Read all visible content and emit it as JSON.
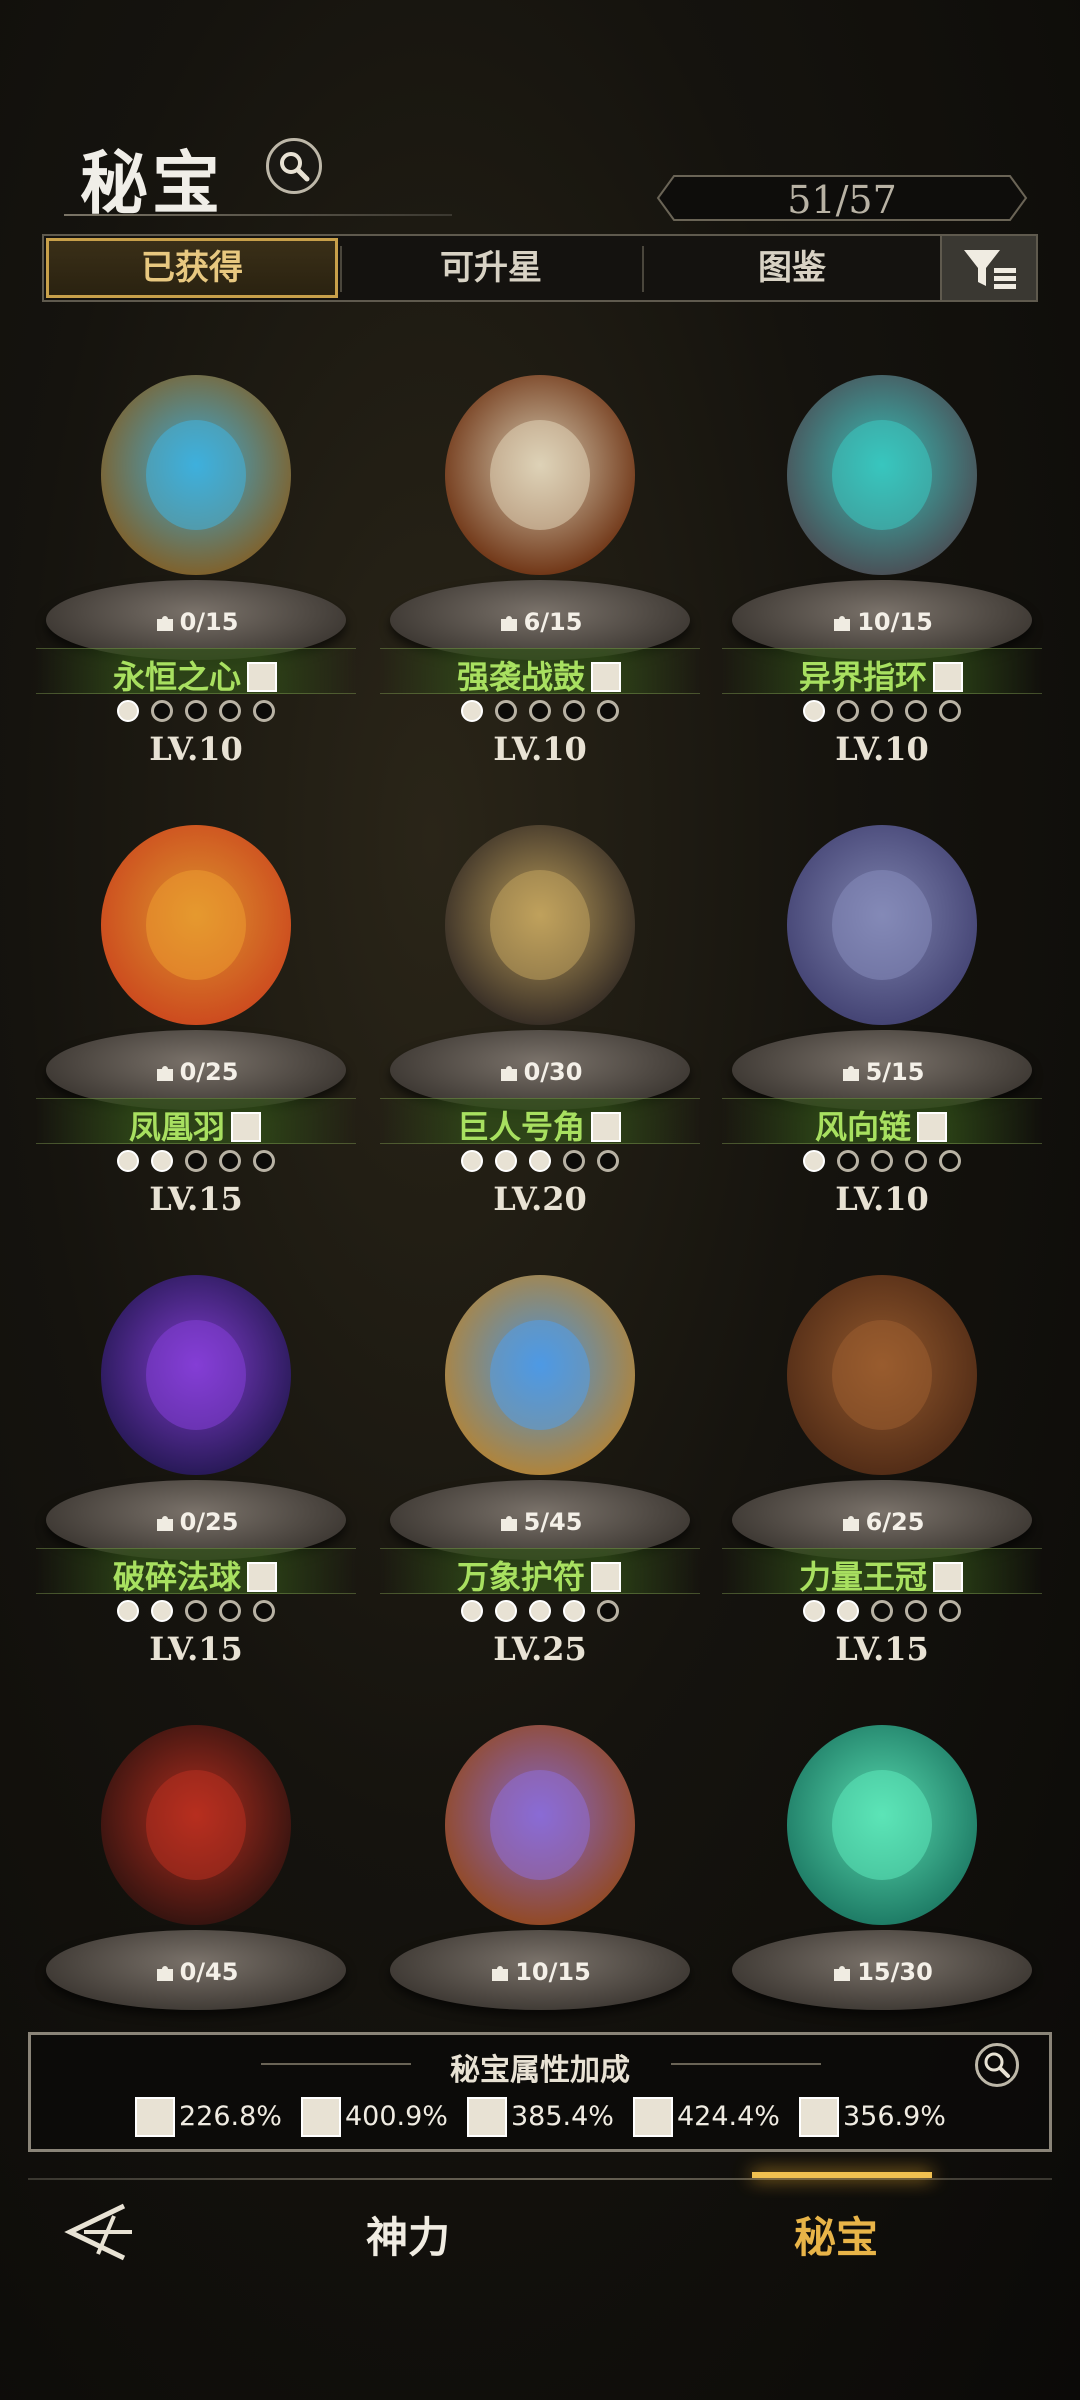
{
  "header": {
    "title": "秘宝",
    "count": "51/57"
  },
  "tabs": [
    {
      "label": "已获得",
      "active": true
    },
    {
      "label": "可升星",
      "active": false
    },
    {
      "label": "图鉴",
      "active": false
    }
  ],
  "items": [
    {
      "name": "永恒之心",
      "fragments": "0/15",
      "level": "LV.10",
      "stars_lit": 1,
      "stars_total": 5,
      "type_icon": "swirl-icon"
    },
    {
      "name": "强袭战鼓",
      "fragments": "6/15",
      "level": "LV.10",
      "stars_lit": 1,
      "stars_total": 5,
      "type_icon": "fist-icon"
    },
    {
      "name": "异界指环",
      "fragments": "10/15",
      "level": "LV.10",
      "stars_lit": 1,
      "stars_total": 5,
      "type_icon": "heart-icon"
    },
    {
      "name": "凤凰羽",
      "fragments": "0/25",
      "level": "LV.15",
      "stars_lit": 2,
      "stars_total": 5,
      "type_icon": "fist-icon"
    },
    {
      "name": "巨人号角",
      "fragments": "0/30",
      "level": "LV.20",
      "stars_lit": 3,
      "stars_total": 5,
      "type_icon": "boot-icon"
    },
    {
      "name": "风向链",
      "fragments": "5/15",
      "level": "LV.10",
      "stars_lit": 1,
      "stars_total": 5,
      "type_icon": "fist-icon"
    },
    {
      "name": "破碎法球",
      "fragments": "0/25",
      "level": "LV.15",
      "stars_lit": 2,
      "stars_total": 5,
      "type_icon": "boot-icon"
    },
    {
      "name": "万象护符",
      "fragments": "5/45",
      "level": "LV.25",
      "stars_lit": 4,
      "stars_total": 5,
      "type_icon": "boot-icon"
    },
    {
      "name": "力量王冠",
      "fragments": "6/25",
      "level": "LV.15",
      "stars_lit": 2,
      "stars_total": 5,
      "type_icon": "swirl-icon"
    },
    {
      "name": "",
      "fragments": "0/45"
    },
    {
      "name": "",
      "fragments": "10/15"
    },
    {
      "name": "",
      "fragments": "15/30"
    }
  ],
  "bonus": {
    "title": "秘宝属性加成",
    "stats": [
      {
        "icon": "sword-icon",
        "value": "226.8%"
      },
      {
        "icon": "fist-icon",
        "value": "400.9%"
      },
      {
        "icon": "swirl-icon",
        "value": "385.4%"
      },
      {
        "icon": "boot-icon",
        "value": "424.4%"
      },
      {
        "icon": "heart-icon",
        "value": "356.9%"
      }
    ]
  },
  "nav": {
    "god_label": "神力",
    "treasure_label": "秘宝"
  },
  "colors": {
    "accent_gold": "#e8b448",
    "name_green": "#a8e060"
  }
}
